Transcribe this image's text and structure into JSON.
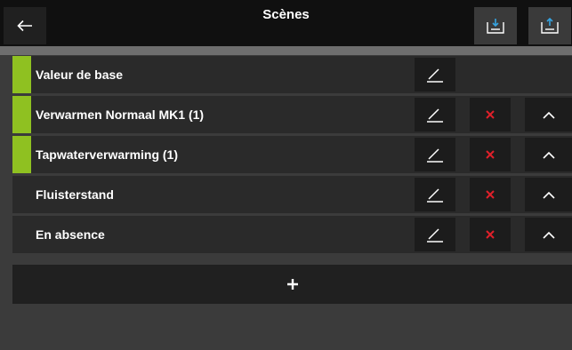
{
  "header": {
    "title": "Scènes",
    "back_icon": "arrow-left-icon",
    "import_icon": "tray-download-icon",
    "export_icon": "tray-upload-icon"
  },
  "colors": {
    "accent": "#8fc121",
    "delete": "#e0202a"
  },
  "scenes": [
    {
      "label": "Valeur de base",
      "active": true,
      "deletable": false,
      "movable": false
    },
    {
      "label": "Verwarmen Normaal MK1 (1)",
      "active": true,
      "deletable": true,
      "movable": true
    },
    {
      "label": "Tapwaterverwarming (1)",
      "active": true,
      "deletable": true,
      "movable": true
    },
    {
      "label": "Fluisterstand",
      "active": false,
      "deletable": true,
      "movable": true
    },
    {
      "label": "En absence",
      "active": false,
      "deletable": true,
      "movable": true
    }
  ],
  "add_button": {
    "icon": "plus-icon"
  }
}
